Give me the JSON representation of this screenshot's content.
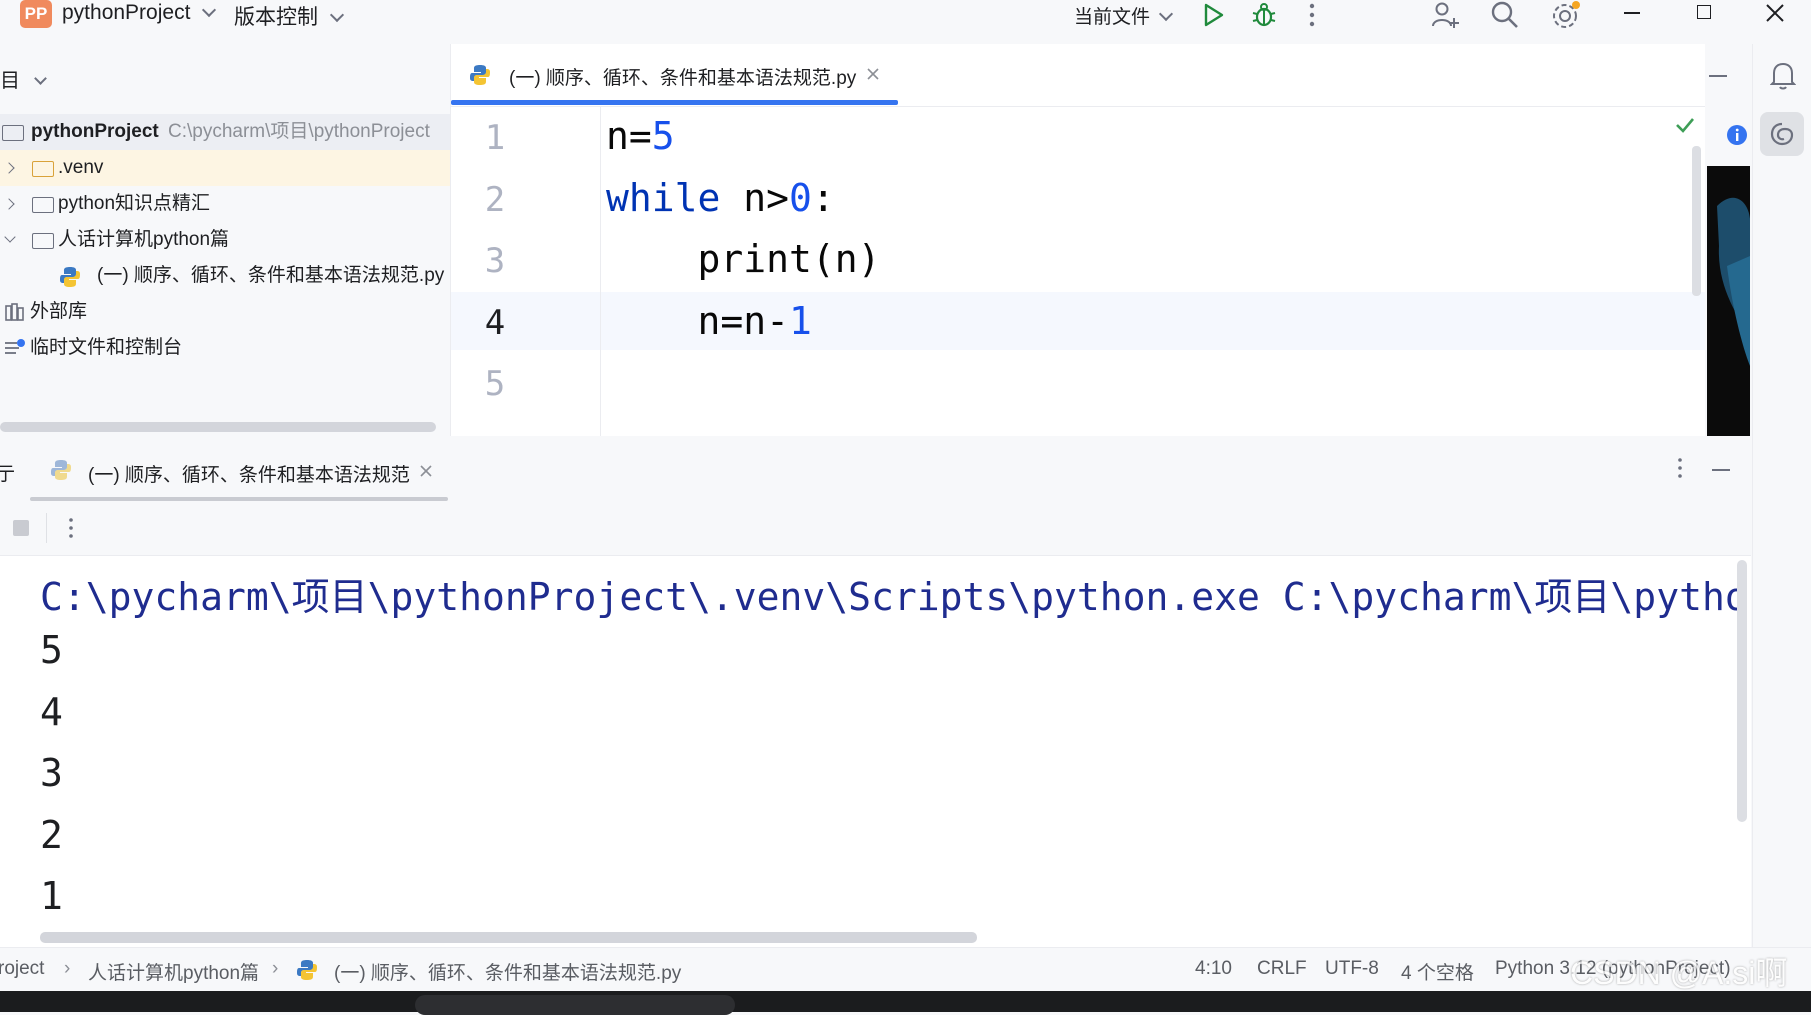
{
  "titlebar": {
    "project_badge": "PP",
    "project_name": "pythonProject",
    "vcs_menu": "版本控制",
    "run_config": "当前文件"
  },
  "project_panel": {
    "header_label": "目",
    "items": [
      {
        "label": "pythonProject",
        "path": "C:\\pycharm\\项目\\pythonProject"
      },
      {
        "label": ".venv"
      },
      {
        "label": "python知识点精汇"
      },
      {
        "label": "人话计算机python篇"
      },
      {
        "label": "(一) 顺序、循环、条件和基本语法规范.py"
      },
      {
        "label": "外部库"
      },
      {
        "label": "临时文件和控制台"
      }
    ]
  },
  "editor": {
    "tab_label": "(一) 顺序、循环、条件和基本语法规范.py",
    "line_numbers": [
      "1",
      "2",
      "3",
      "4",
      "5"
    ],
    "current_line": 4,
    "code": {
      "l1_a": "n=",
      "l1_b": "5",
      "l2_kw": "while",
      "l2_a": " n>",
      "l2_b": "0",
      "l2_c": ":",
      "l3": "    print(n)",
      "l4_a": "    n=n-",
      "l4_b": "1"
    }
  },
  "run_panel": {
    "header_label": "亍",
    "tab_label": "(一) 顺序、循环、条件和基本语法规范",
    "command": "C:\\pycharm\\项目\\pythonProject\\.venv\\Scripts\\python.exe C:\\pycharm\\项目\\pytho",
    "output": [
      "5",
      "4",
      "3",
      "2",
      "1"
    ]
  },
  "statusbar": {
    "crumb1": "roject",
    "crumb2": "人话计算机python篇",
    "crumb3": "(一) 顺序、循环、条件和基本语法规范.py",
    "position": "4:10",
    "line_sep": "CRLF",
    "encoding": "UTF-8",
    "indent": "4 个空格",
    "interpreter": "Python 3.12 (pythonProject)"
  },
  "watermark": "CSDN @A.si啊",
  "colors": {
    "keyword": "#0033b3",
    "number": "#1750eb",
    "console_path": "#1f2c8f",
    "tab_underline": "#3574f0",
    "current_line_bg": "#f5f8fe",
    "badge_bg": "#f08a5d"
  }
}
